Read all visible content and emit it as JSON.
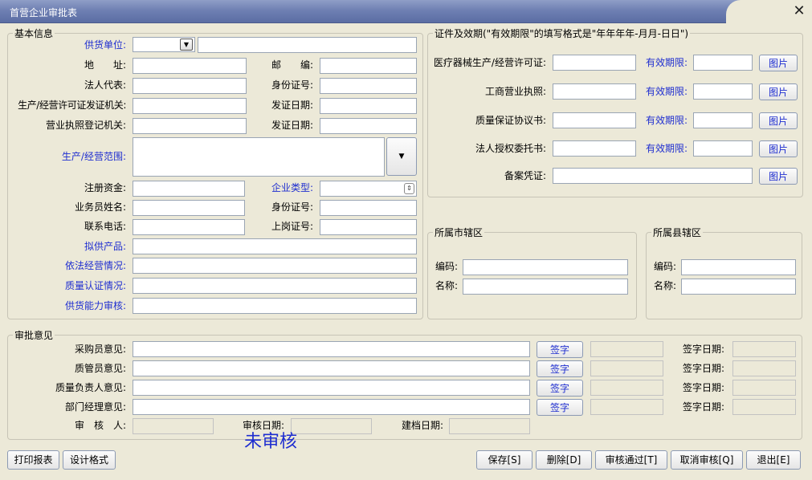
{
  "window": {
    "title": "首营企业审批表",
    "close_icon": "close-icon"
  },
  "basic": {
    "legend": "基本信息",
    "supplier_label": "供货单位:",
    "address_label": "地　　址:",
    "postcode_label": "邮　　编:",
    "legal_rep_label": "法人代表:",
    "id_label": "身份证号:",
    "license_authority_label": "生产/经营许可证发证机关:",
    "issue_date_label": "发证日期:",
    "biz_license_authority_label": "营业执照登记机关:",
    "issue_date_label2": "发证日期:",
    "scope_label": "生产/经营范围:",
    "capital_label": "注册资金:",
    "company_type_label": "企业类型:",
    "salesman_label": "业务员姓名:",
    "salesman_id_label": "身份证号:",
    "phone_label": "联系电话:",
    "post_cert_label": "上岗证号:",
    "product_label": "拟供产品:",
    "legal_op_label": "依法经营情况:",
    "quality_cert_label": "质量认证情况:",
    "supply_cap_label": "供货能力审核:"
  },
  "certs": {
    "legend": "证件及效期(\"有效期限\"的填写格式是\"年年年年-月月-日日\")",
    "items": [
      {
        "label": "医疗器械生产/经营许可证:",
        "validity": "有效期限:",
        "button": "图片"
      },
      {
        "label": "工商营业执照:",
        "validity": "有效期限:",
        "button": "图片"
      },
      {
        "label": "质量保证协议书:",
        "validity": "有效期限:",
        "button": "图片"
      },
      {
        "label": "法人授权委托书:",
        "validity": "有效期限:",
        "button": "图片"
      }
    ],
    "record_label": "备案凭证:",
    "record_button": "图片"
  },
  "city": {
    "legend": "所属市辖区",
    "code_label": "编码:",
    "name_label": "名称:"
  },
  "county": {
    "legend": "所属县辖区",
    "code_label": "编码:",
    "name_label": "名称:"
  },
  "approval": {
    "legend": "审批意见",
    "rows": [
      {
        "label": "采购员意见:",
        "sign": "签字",
        "date_label": "签字日期:"
      },
      {
        "label": "质管员意见:",
        "sign": "签字",
        "date_label": "签字日期:"
      },
      {
        "label": "质量负责人意见:",
        "sign": "签字",
        "date_label": "签字日期:"
      },
      {
        "label": "部门经理意见:",
        "sign": "签字",
        "date_label": "签字日期:"
      }
    ],
    "reviewer_label": "审　核　人:",
    "review_date_label": "审核日期:",
    "archive_date_label": "建档日期:"
  },
  "footer": {
    "print": "打印报表",
    "design": "设计格式",
    "status": "未审核",
    "save": "保存[S]",
    "delete": "删除[D]",
    "approve": "审核通过[T]",
    "cancel_approve": "取消审核[Q]",
    "exit": "退出[E]"
  },
  "colors": {
    "label_blue": "#1f2ed0",
    "background": "#ECE9D8",
    "title_bar": "#6f80b3"
  }
}
